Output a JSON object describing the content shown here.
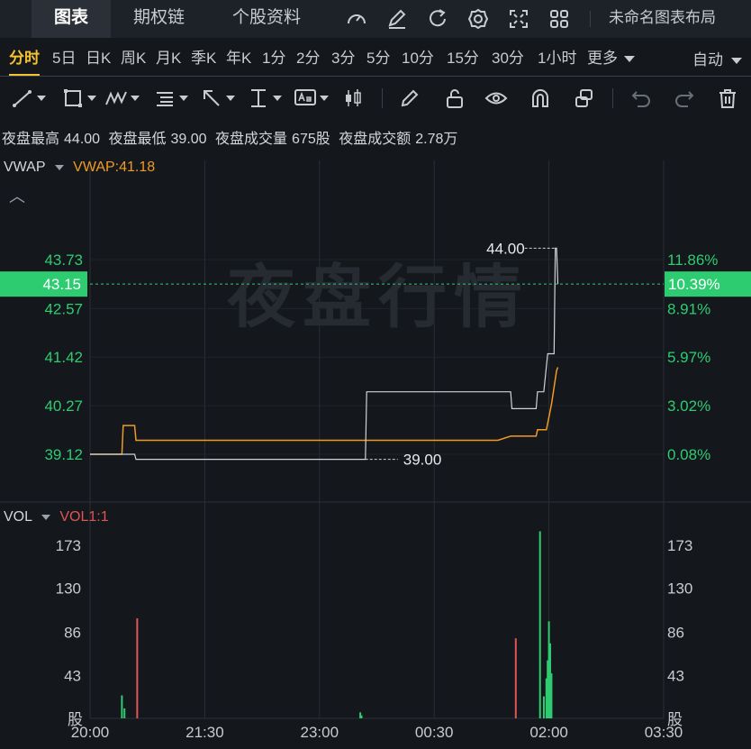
{
  "nav": {
    "tabs": [
      "图表",
      "期权链",
      "个股资料"
    ],
    "active_tab": "图表",
    "layout_name": "未命名图表布局"
  },
  "periods": {
    "items": [
      "分时",
      "5日",
      "日K",
      "周K",
      "月K",
      "季K",
      "年K",
      "1分",
      "2分",
      "3分",
      "5分",
      "10分",
      "15分",
      "30分",
      "1小时",
      "更多"
    ],
    "active": "分时",
    "auto": "自动"
  },
  "stats": {
    "high_label": "夜盘最高",
    "high": "44.00",
    "low_label": "夜盘最低",
    "low": "39.00",
    "vol_label": "夜盘成交量",
    "vol": "675股",
    "amount_label": "夜盘成交额",
    "amount": "2.78万"
  },
  "watermark": "夜盘行情",
  "colors": {
    "up": "#2ecc71",
    "down": "#e05555",
    "vwap": "#f09a23",
    "price": "#d0d3d8",
    "accent": "#f2c230",
    "bg": "#14171c"
  },
  "chart_data": [
    {
      "type": "line",
      "indicator_label": "VWAP",
      "indicator_value": "VWAP:41.18",
      "x_ticks": [
        "20:00",
        "21:30",
        "23:00",
        "00:30",
        "02:00",
        "03:30"
      ],
      "y_ticks_left": [
        "43.73",
        "42.57",
        "41.42",
        "40.27",
        "39.12"
      ],
      "y_ticks_right": [
        "11.86%",
        "8.91%",
        "5.97%",
        "3.02%",
        "0.08%"
      ],
      "ylim": [
        38.15,
        44.8
      ],
      "current_price": "43.15",
      "current_pct": "10.39%",
      "high_marker": "44.00",
      "low_marker": "39.00",
      "series": [
        {
          "name": "price",
          "points": [
            [
              0,
              39.12
            ],
            [
              35,
              39.12
            ],
            [
              36,
              39.0
            ],
            [
              210,
              39.0
            ],
            [
              216,
              39.0
            ],
            [
              217,
              40.6
            ],
            [
              330,
              40.6
            ],
            [
              331,
              40.2
            ],
            [
              350,
              40.2
            ],
            [
              351,
              40.6
            ],
            [
              356,
              40.6
            ],
            [
              359,
              41.5
            ],
            [
              364,
              41.5
            ],
            [
              365,
              44.0
            ],
            [
              366,
              44.0
            ],
            [
              367,
              43.15
            ]
          ]
        },
        {
          "name": "VWAP",
          "points": [
            [
              0,
              39.12
            ],
            [
              25,
              39.12
            ],
            [
              26,
              39.8
            ],
            [
              35,
              39.8
            ],
            [
              36,
              39.45
            ],
            [
              210,
              39.45
            ],
            [
              217,
              39.45
            ],
            [
              320,
              39.45
            ],
            [
              330,
              39.55
            ],
            [
              350,
              39.55
            ],
            [
              351,
              39.7
            ],
            [
              358,
              39.7
            ],
            [
              362,
              40.3
            ],
            [
              366,
              41.1
            ],
            [
              367,
              41.18
            ]
          ]
        }
      ]
    },
    {
      "type": "bar",
      "indicator_label": "VOL",
      "indicator_value": "VOL1:1",
      "y_ticks": [
        "173",
        "130",
        "86",
        "43"
      ],
      "unit": "股",
      "ylim": [
        0,
        205
      ],
      "bars": [
        {
          "x": 25,
          "v": 23,
          "dir": "up"
        },
        {
          "x": 27,
          "v": 10,
          "dir": "up"
        },
        {
          "x": 37,
          "v": 100,
          "dir": "down"
        },
        {
          "x": 212,
          "v": 6,
          "dir": "up"
        },
        {
          "x": 213,
          "v": 3,
          "dir": "up"
        },
        {
          "x": 334,
          "v": 80,
          "dir": "down"
        },
        {
          "x": 353,
          "v": 187,
          "dir": "up"
        },
        {
          "x": 356,
          "v": 22,
          "dir": "up"
        },
        {
          "x": 358,
          "v": 40,
          "dir": "up"
        },
        {
          "x": 359,
          "v": 58,
          "dir": "up"
        },
        {
          "x": 360,
          "v": 97,
          "dir": "up"
        },
        {
          "x": 361,
          "v": 75,
          "dir": "up"
        },
        {
          "x": 362,
          "v": 45,
          "dir": "up"
        }
      ]
    }
  ]
}
